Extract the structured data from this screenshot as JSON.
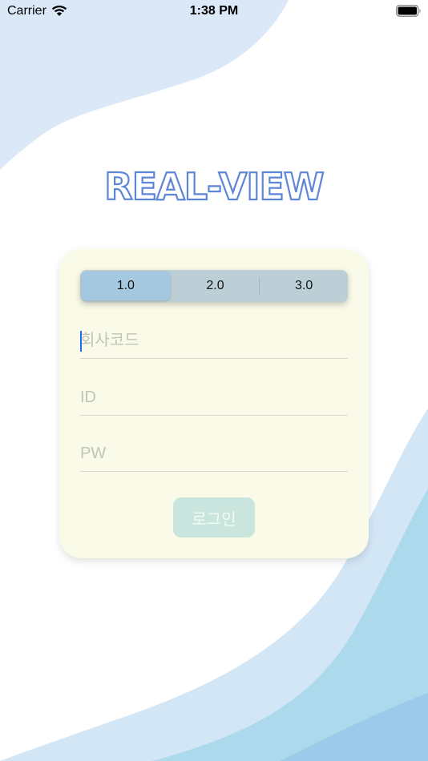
{
  "status_bar": {
    "carrier": "Carrier",
    "time": "1:38 PM"
  },
  "app": {
    "logo": "REAL-VIEW"
  },
  "version_selector": {
    "options": [
      "1.0",
      "2.0",
      "3.0"
    ],
    "selected": "1.0"
  },
  "form": {
    "company_code_placeholder": "회사코드",
    "id_placeholder": "ID",
    "pw_placeholder": "PW",
    "login_label": "로그인"
  },
  "colors": {
    "logo_stroke": "#5e86d6",
    "card_background": "#fafae8",
    "segment_selected": "#a3c8e0",
    "login_button": "#c9e5dd",
    "wave_light": "#dbe8f7",
    "wave_mid": "#acd9ec"
  }
}
